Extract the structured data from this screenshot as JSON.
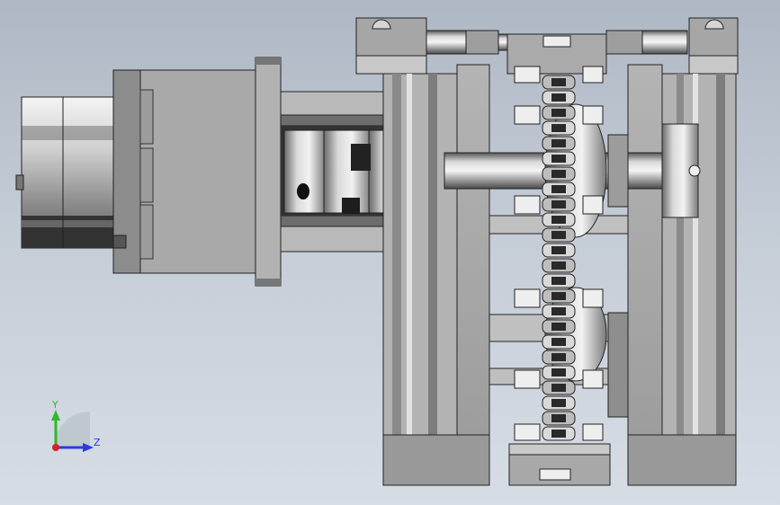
{
  "viewport": {
    "background_top": "#aeb8c4",
    "background_bottom": "#d6dde5"
  },
  "model": {
    "description_icons": [
      "stepper-motor",
      "shaft-coupling",
      "roller-chain",
      "sprocket",
      "aluminum-extrusion-frame",
      "pillow-block-bearing"
    ]
  },
  "triad": {
    "y_label": "Y",
    "z_label": "Z",
    "y_color": "#2db82d",
    "z_color": "#2a3ae0",
    "x_color": "#d8202a"
  }
}
